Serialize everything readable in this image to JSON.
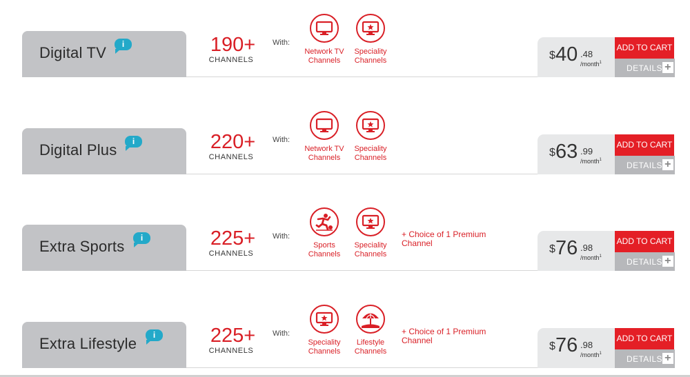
{
  "common": {
    "channels_word": "CHANNELS",
    "with_label": "With:",
    "add_to_cart_label": "ADD TO CART",
    "details_label": "DETAILS",
    "info_glyph": "i",
    "plus_glyph": "+",
    "currency": "$",
    "per_month": "/month",
    "footnote": "1",
    "accent_color": "#d91f26"
  },
  "packages": [
    {
      "name": "Digital TV",
      "channels": "190+",
      "features": [
        {
          "icon": "tv-icon",
          "line1": "Network TV",
          "line2": "Channels"
        },
        {
          "icon": "tv-star-icon",
          "line1": "Speciality",
          "line2": "Channels"
        }
      ],
      "extra": "",
      "price_main": "40",
      "price_cents": ".48"
    },
    {
      "name": "Digital Plus",
      "channels": "220+",
      "features": [
        {
          "icon": "tv-icon",
          "line1": "Network TV",
          "line2": "Channels"
        },
        {
          "icon": "tv-star-icon",
          "line1": "Speciality",
          "line2": "Channels"
        }
      ],
      "extra": "",
      "price_main": "63",
      "price_cents": ".99"
    },
    {
      "name": "Extra Sports",
      "channels": "225+",
      "features": [
        {
          "icon": "sports-icon",
          "line1": "Sports",
          "line2": "Channels"
        },
        {
          "icon": "tv-star-icon",
          "line1": "Speciality",
          "line2": "Channels"
        }
      ],
      "extra": "+ Choice of 1 Premium Channel",
      "price_main": "76",
      "price_cents": ".98"
    },
    {
      "name": "Extra Lifestyle",
      "channels": "225+",
      "features": [
        {
          "icon": "tv-star-icon",
          "line1": "Speciality",
          "line2": "Channels"
        },
        {
          "icon": "beach-umbrella-icon",
          "line1": "Lifestyle",
          "line2": "Channels"
        }
      ],
      "extra": "+ Choice of 1 Premium Channel",
      "price_main": "76",
      "price_cents": ".98"
    }
  ]
}
